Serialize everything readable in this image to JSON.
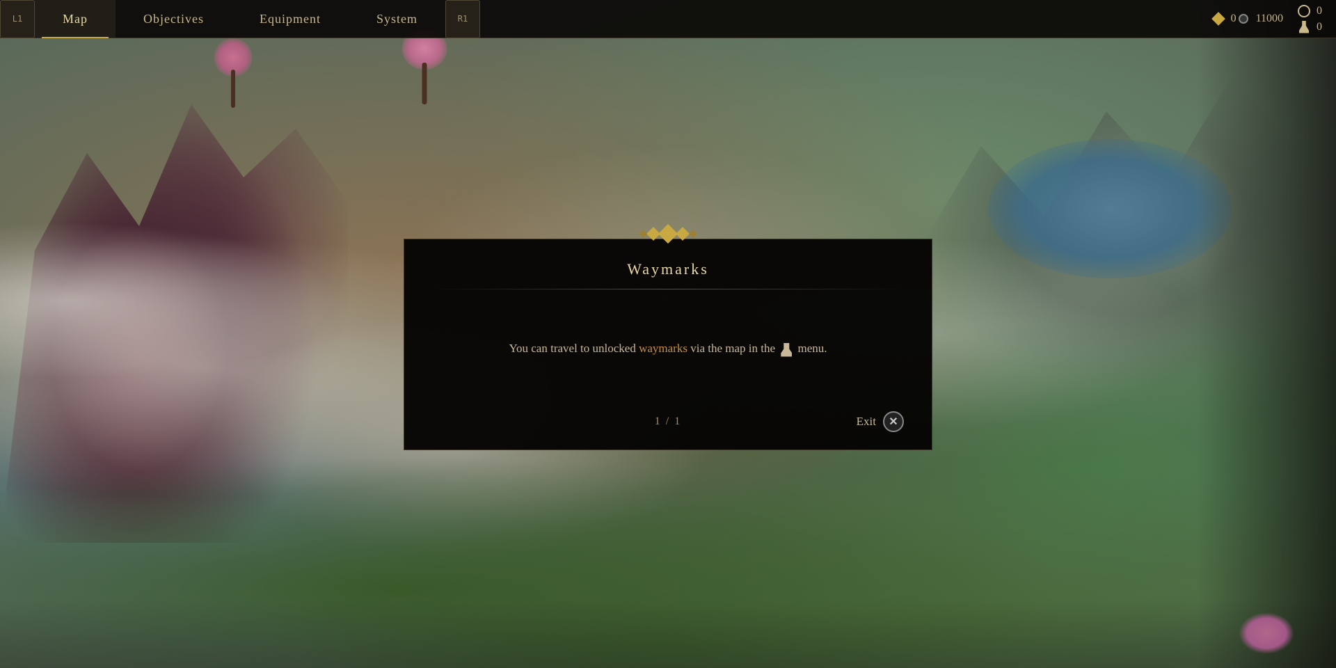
{
  "nav": {
    "left_button": "L1",
    "right_button": "R1",
    "tabs": [
      {
        "id": "map",
        "label": "Map",
        "active": true
      },
      {
        "id": "objectives",
        "label": "Objectives",
        "active": false
      },
      {
        "id": "equipment",
        "label": "Equipment",
        "active": false
      },
      {
        "id": "system",
        "label": "System",
        "active": false
      }
    ],
    "stats": {
      "currency_icon": "diamond",
      "currency_value": "0",
      "record_icon": "circle",
      "record_value": "11000",
      "globe_value": "0",
      "flask_value": "0"
    }
  },
  "modal": {
    "title": "Waymarks",
    "body_text_before": "You can travel to unlocked ",
    "highlight_word": "waymarks",
    "body_text_after": " via the map in the",
    "body_text_end": "menu.",
    "page_current": "1",
    "page_total": "1",
    "exit_label": "Exit"
  }
}
